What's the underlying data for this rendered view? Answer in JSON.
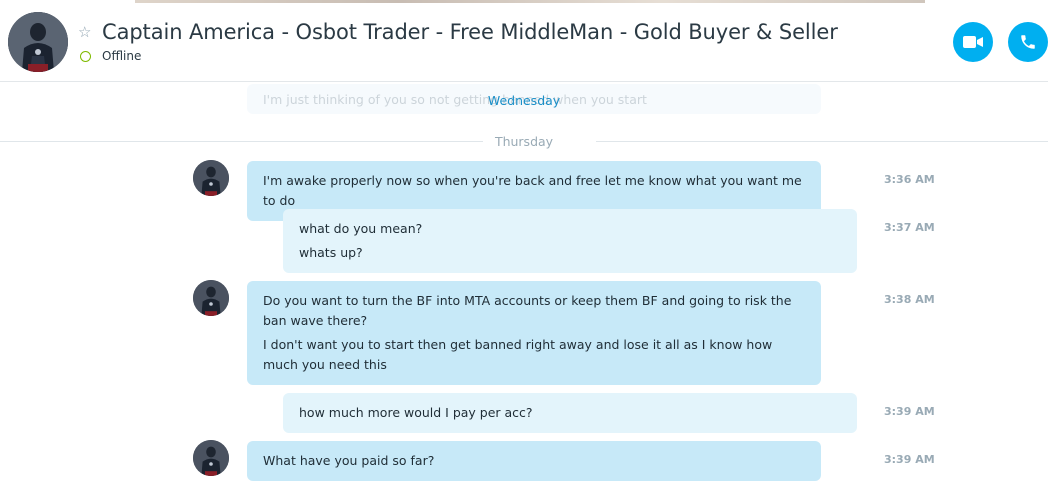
{
  "header": {
    "contact_name": "Captain America - Osbot Trader - Free MiddleMan - Gold Buyer & Seller",
    "status": "Offline",
    "favorite_icon": "star-outline-icon",
    "video_call_icon": "video-camera-icon",
    "audio_call_icon": "phone-icon",
    "accent_color": "#00aff0",
    "status_color": "#7fba00"
  },
  "conversation": {
    "ghost_message": "I'm just thinking of you so not getting banned when you start",
    "day_separators": {
      "wednesday": "Wednesday",
      "thursday": "Thursday"
    },
    "messages": [
      {
        "direction": "incoming",
        "lines": [
          "I'm awake properly now so when you're back and free let me know what you want me to do"
        ],
        "time": "3:36 AM"
      },
      {
        "direction": "outgoing",
        "lines": [
          "what do you mean?",
          "whats up?"
        ],
        "time": "3:37 AM"
      },
      {
        "direction": "incoming",
        "lines": [
          "Do you want to turn the BF into MTA accounts or keep them BF and going to risk the ban wave there?",
          "I don't want you to start then get banned right away and lose it all as I know how much you need this"
        ],
        "time": "3:38 AM"
      },
      {
        "direction": "outgoing",
        "lines": [
          "how much more would I pay per acc?"
        ],
        "time": "3:39 AM"
      },
      {
        "direction": "incoming",
        "lines": [
          "What have you paid so far?"
        ],
        "time": "3:39 AM"
      }
    ],
    "incoming_bubble_color": "#c7e9f8",
    "outgoing_bubble_color": "#e3f4fb"
  }
}
